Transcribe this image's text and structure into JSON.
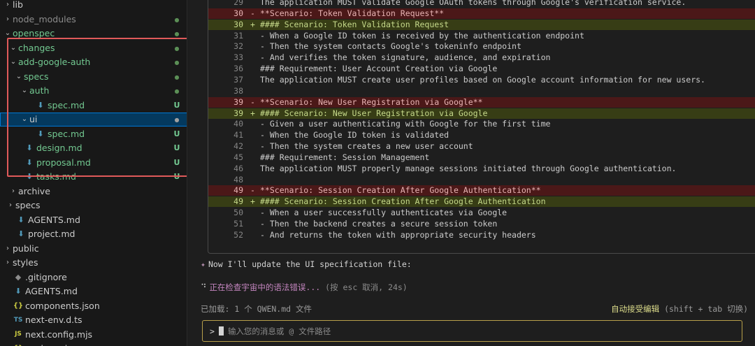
{
  "explorer": {
    "items": [
      {
        "label": "lib",
        "chev": "›",
        "icon": "",
        "indent": 0,
        "status": "",
        "color": ""
      },
      {
        "label": "node_modules",
        "chev": "›",
        "icon": "",
        "indent": 0,
        "status": "dot",
        "color": "dim"
      },
      {
        "label": "openspec",
        "chev": "⌄",
        "icon": "",
        "indent": 0,
        "status": "dot",
        "color": "green"
      },
      {
        "label": "changes",
        "chev": "⌄",
        "icon": "",
        "indent": 1,
        "status": "dot",
        "color": "green"
      },
      {
        "label": "add-google-auth",
        "chev": "⌄",
        "icon": "",
        "indent": 1,
        "status": "dot",
        "color": "green"
      },
      {
        "label": "specs",
        "chev": "⌄",
        "icon": "",
        "indent": 2,
        "status": "dot",
        "color": "green"
      },
      {
        "label": "auth",
        "chev": "⌄",
        "icon": "",
        "indent": 3,
        "status": "dot",
        "color": "green"
      },
      {
        "label": "spec.md",
        "chev": "",
        "icon": "md",
        "indent": 4,
        "status": "U",
        "color": "green"
      },
      {
        "label": "ui",
        "chev": "⌄",
        "icon": "",
        "indent": 3,
        "status": "dot",
        "color": "",
        "selected": true
      },
      {
        "label": "spec.md",
        "chev": "",
        "icon": "md",
        "indent": 4,
        "status": "U",
        "color": "green"
      },
      {
        "label": "design.md",
        "chev": "",
        "icon": "md",
        "indent": 2,
        "status": "U",
        "color": "green"
      },
      {
        "label": "proposal.md",
        "chev": "",
        "icon": "md",
        "indent": 2,
        "status": "U",
        "color": "green"
      },
      {
        "label": "tasks.md",
        "chev": "",
        "icon": "md",
        "indent": 2,
        "status": "U",
        "color": "green"
      },
      {
        "label": "archive",
        "chev": "›",
        "icon": "",
        "indent": 1,
        "status": "",
        "color": ""
      },
      {
        "label": "specs",
        "chev": "›",
        "icon": "",
        "indent": 0.5,
        "status": "",
        "color": ""
      },
      {
        "label": "AGENTS.md",
        "chev": "",
        "icon": "md",
        "indent": 0.5,
        "status": "",
        "color": ""
      },
      {
        "label": "project.md",
        "chev": "",
        "icon": "md",
        "indent": 0.5,
        "status": "",
        "color": ""
      },
      {
        "label": "public",
        "chev": "›",
        "icon": "",
        "indent": 0,
        "status": "",
        "color": ""
      },
      {
        "label": "styles",
        "chev": "›",
        "icon": "",
        "indent": 0,
        "status": "",
        "color": ""
      },
      {
        "label": ".gitignore",
        "chev": "",
        "icon": "git",
        "indent": 0,
        "status": "",
        "color": ""
      },
      {
        "label": "AGENTS.md",
        "chev": "",
        "icon": "md",
        "indent": 0,
        "status": "",
        "color": ""
      },
      {
        "label": "components.json",
        "chev": "",
        "icon": "json",
        "indent": 0,
        "status": "",
        "color": ""
      },
      {
        "label": "next-env.d.ts",
        "chev": "",
        "icon": "ts",
        "indent": 0,
        "status": "",
        "color": ""
      },
      {
        "label": "next.config.mjs",
        "chev": "",
        "icon": "js",
        "indent": 0,
        "status": "",
        "color": ""
      },
      {
        "label": "package.json",
        "chev": "",
        "icon": "json",
        "indent": 0,
        "status": "",
        "color": ""
      }
    ],
    "icon_glyphs": {
      "md": "⬇",
      "json": "{}",
      "ts": "TS",
      "js": "JS",
      "git": "◆"
    }
  },
  "diff": {
    "lines": [
      {
        "ln": "29",
        "mark": "",
        "kind": "ctx",
        "text": "The application MUST validate Google OAuth tokens through Google's verification service."
      },
      {
        "ln": "30",
        "mark": "-",
        "kind": "del",
        "text": "**Scenario: Token Validation Request**"
      },
      {
        "ln": "30",
        "mark": "+",
        "kind": "add",
        "text": "#### Scenario: Token Validation Request"
      },
      {
        "ln": "31",
        "mark": "",
        "kind": "ctx",
        "text": "- When a Google ID token is received by the authentication endpoint"
      },
      {
        "ln": "32",
        "mark": "",
        "kind": "ctx",
        "text": "- Then the system contacts Google's tokeninfo endpoint"
      },
      {
        "ln": "33",
        "mark": "",
        "kind": "ctx",
        "text": "- And verifies the token signature, audience, and expiration"
      },
      {
        "ln": "36",
        "mark": "",
        "kind": "ctx",
        "text": "### Requirement: User Account Creation via Google"
      },
      {
        "ln": "37",
        "mark": "",
        "kind": "ctx",
        "text": "The application MUST create user profiles based on Google account information for new users."
      },
      {
        "ln": "38",
        "mark": "",
        "kind": "ctx",
        "text": ""
      },
      {
        "ln": "39",
        "mark": "-",
        "kind": "del",
        "text": "**Scenario: New User Registration via Google**"
      },
      {
        "ln": "39",
        "mark": "+",
        "kind": "add",
        "text": "#### Scenario: New User Registration via Google"
      },
      {
        "ln": "40",
        "mark": "",
        "kind": "ctx",
        "text": "- Given a user authenticating with Google for the first time"
      },
      {
        "ln": "41",
        "mark": "",
        "kind": "ctx",
        "text": "- When the Google ID token is validated"
      },
      {
        "ln": "42",
        "mark": "",
        "kind": "ctx",
        "text": "- Then the system creates a new user account"
      },
      {
        "ln": "45",
        "mark": "",
        "kind": "ctx",
        "text": "### Requirement: Session Management"
      },
      {
        "ln": "46",
        "mark": "",
        "kind": "ctx",
        "text": "The application MUST properly manage sessions initiated through Google authentication."
      },
      {
        "ln": "48",
        "mark": "",
        "kind": "ctx",
        "text": ""
      },
      {
        "ln": "49",
        "mark": "-",
        "kind": "del",
        "text": "**Scenario: Session Creation After Google Authentication**"
      },
      {
        "ln": "49",
        "mark": "+",
        "kind": "add",
        "text": "#### Scenario: Session Creation After Google Authentication"
      },
      {
        "ln": "50",
        "mark": "",
        "kind": "ctx",
        "text": "- When a user successfully authenticates via Google"
      },
      {
        "ln": "51",
        "mark": "",
        "kind": "ctx",
        "text": "- Then the backend creates a secure session token"
      },
      {
        "ln": "52",
        "mark": "",
        "kind": "ctx",
        "text": "- And returns the token with appropriate security headers"
      }
    ]
  },
  "chat": {
    "status_spark": "✦",
    "status_text": "Now I'll update the UI specification file:",
    "thinking_spinner": "⠙",
    "thinking_text": "正在检查宇宙中的语法错误...",
    "thinking_hint": " (按 esc 取消, 24s)",
    "loaded_text": "已加载: 1 个 QWEN.md 文件",
    "autoaccept_label": "自动接受编辑",
    "autoaccept_keys": " (shift + tab 切换)",
    "input_prompt": ">",
    "input_placeholder": "输入您的消息或 @ 文件路径"
  }
}
